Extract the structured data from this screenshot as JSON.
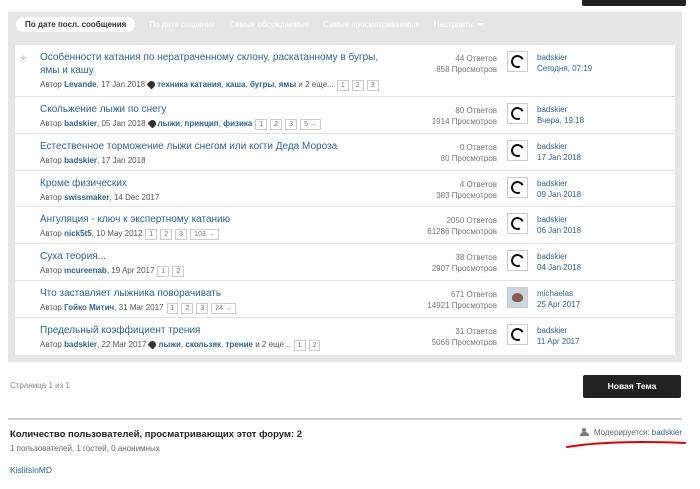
{
  "tabs": [
    {
      "label": "По дате посл. сообщения",
      "active": true
    },
    {
      "label": "По дате создания"
    },
    {
      "label": "Самые обсуждаемые"
    },
    {
      "label": "Самые просматриваемые"
    },
    {
      "label": "Настроить"
    }
  ],
  "topics": [
    {
      "title_line1": "Особенности катания по нератраченному склону, раскатанному в бугры,",
      "title_line2": "ямы и кашу",
      "author_prefix": "Автор",
      "author": "Levande",
      "date": "17 Jan 2018",
      "tags": [
        "техника катания",
        "каша",
        "бугры",
        "ямы"
      ],
      "tags_more": "и 2 еще...",
      "pages": [
        "1",
        "2",
        "3"
      ],
      "replies": "44 Ответов",
      "views": "858 Просмотров",
      "last_user": "badskier",
      "last_date": "Сегодня, 07:19"
    },
    {
      "title_line1": "Скольжение лыжи по снегу",
      "author_prefix": "Автор",
      "author": "badskier",
      "date": "05 Jan 2018",
      "tags": [
        "лыжи",
        "принцип",
        "физика"
      ],
      "pages": [
        "1",
        "2",
        "3",
        "5 →"
      ],
      "replies": "80 Ответов",
      "views": "1914 Просмотров",
      "last_user": "badskier",
      "last_date": "Вчера, 19:18"
    },
    {
      "title_line1": "Естественное торможение лыжи снегом или когти Деда Мороза",
      "author_prefix": "Автор",
      "author": "badskier",
      "date": "17 Jan 2018",
      "replies": "0 Ответов",
      "views": "80 Просмотров",
      "last_user": "badskier",
      "last_date": "17 Jan 2018"
    },
    {
      "title_line1": "Кроме физических",
      "author_prefix": "Автор",
      "author": "swissmaker",
      "date": "14 Dec 2017",
      "replies": "4 Ответов",
      "views": "383 Просмотров",
      "last_user": "badskier",
      "last_date": "09 Jan 2018"
    },
    {
      "title_line1": "Ангуляция - ключ к экспертному катанию",
      "author_prefix": "Автор",
      "author": "nick5t5",
      "date": "10 May 2012",
      "pages": [
        "1",
        "2",
        "3",
        "103 →"
      ],
      "replies": "2050 Ответов",
      "views": "61286 Просмотров",
      "last_user": "badskier",
      "last_date": "06 Jan 2018"
    },
    {
      "title_line1": "Суха теория...",
      "author_prefix": "Автор",
      "author": "mcureenab",
      "date": "19 Apr 2017",
      "pages": [
        "1",
        "2"
      ],
      "replies": "38 Ответов",
      "views": "2907 Просмотров",
      "last_user": "badskier",
      "last_date": "04 Jan 2018"
    },
    {
      "title_line1": "Что заставляет лыжника поворачивать",
      "author_prefix": "Автор",
      "author": "Гойко Митич",
      "date": "31 Mar 2017",
      "pages": [
        "1",
        "2",
        "3",
        "24 →"
      ],
      "replies": "671 Ответов",
      "views": "14921 Просмотров",
      "last_user": "michaelas",
      "last_date": "25 Apr 2017"
    },
    {
      "title_line1": "Предельный коэффициент трения",
      "author_prefix": "Автор",
      "author": "badskier",
      "date": "22 Mar 2017",
      "tags": [
        "лыжи",
        "скользяк",
        "трение"
      ],
      "tags_more": "и 2 еще...",
      "pages": [
        "1",
        "2"
      ],
      "replies": "31 Ответов",
      "views": "5066 Просмотров",
      "last_user": "badskier",
      "last_date": "11 Apr 2017"
    }
  ],
  "page_info": "Страница 1 из 1",
  "new_topic_button": "Новая Тема",
  "viewers_title": "Количество пользователей, просматривающих этот форум: 2",
  "viewers_sub": "1 пользователей, 1 гостей, 0 анонимных",
  "moderator_label": "Модерируется:",
  "moderator_name": "badskier",
  "online_user": "KislitsinMD",
  "colors": {
    "link": "#2a6496",
    "tabbar": "#e6e6e6",
    "button": "#222222",
    "annotation": "#e00000"
  }
}
